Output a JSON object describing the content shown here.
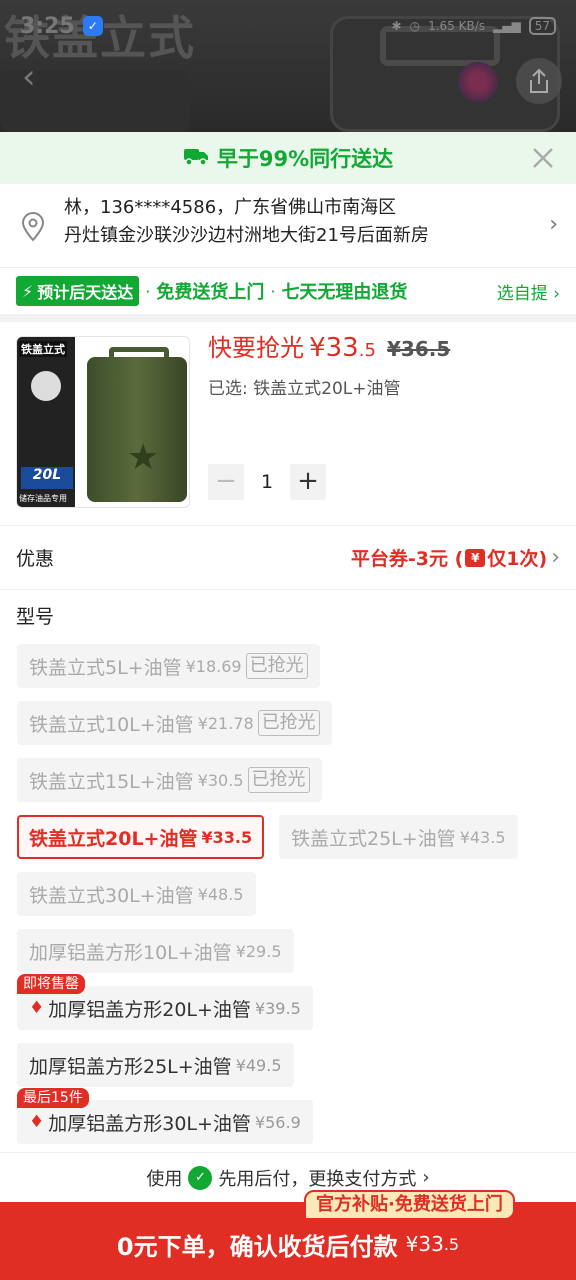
{
  "status_bar": {
    "time": "3:25",
    "network": "1.65 KB/s",
    "battery": "57"
  },
  "background": {
    "title": "铁盖立式"
  },
  "delivery_header": {
    "text": "早于99%同行送达"
  },
  "address": {
    "line1": "林，136****4586，广东省佛山市南海区",
    "line2": "丹灶镇金沙联沙沙边村洲地大街21号后面新房"
  },
  "promises": {
    "badge": "预计后天送达",
    "item1": "免费送货上门",
    "item2": "七天无理由退货",
    "pickup": "选自提"
  },
  "product": {
    "thumb_tag": "铁盖立式",
    "thumb_size": "20L",
    "thumb_note": "储存油品专用",
    "price_label": "快要抢光",
    "price_int": "¥33",
    "price_dec": ".5",
    "price_old": "¥36.5",
    "selected_text": "已选: 铁盖立式20L+油管",
    "quantity": "1",
    "minus": "−",
    "plus": "+"
  },
  "coupon": {
    "label": "优惠",
    "value_pre": "平台券-3元 (",
    "yen": "¥",
    "value_post": "仅1次)"
  },
  "model_title": "型号",
  "options": {
    "o1": {
      "name": "铁盖立式5L+油管",
      "price": "¥18",
      "dec": ".69",
      "sold": "已抢光"
    },
    "o2": {
      "name": "铁盖立式10L+油管",
      "price": "¥21",
      "dec": ".78",
      "sold": "已抢光"
    },
    "o3": {
      "name": "铁盖立式15L+油管",
      "price": "¥30",
      "dec": ".5",
      "sold": "已抢光"
    },
    "o4": {
      "name": "铁盖立式20L+油管",
      "price": "¥33",
      "dec": ".5"
    },
    "o5": {
      "name": "铁盖立式25L+油管",
      "price": "¥43",
      "dec": ".5"
    },
    "o6": {
      "name": "铁盖立式30L+油管",
      "price": "¥48",
      "dec": ".5"
    },
    "o7": {
      "name": "加厚铝盖方形10L+油管",
      "price": "¥29",
      "dec": ".5"
    },
    "o8": {
      "name": "加厚铝盖方形20L+油管",
      "price": "¥39",
      "dec": ".5",
      "tag": "即将售罄"
    },
    "o9": {
      "name": "加厚铝盖方形25L+油管",
      "price": "¥49",
      "dec": ".5"
    },
    "o10": {
      "name": "加厚铝盖方形30L+油管",
      "price": "¥56",
      "dec": ".9",
      "tag": "最后15件"
    }
  },
  "pay": {
    "pre": "使用",
    "post": "先用后付，更换支付方式"
  },
  "buy": {
    "text": "0元下单，确认收货后付款",
    "price": "¥33",
    "dec": ".5",
    "subsidy": "官方补贴·免费送货上门"
  },
  "colors": {
    "accent": "#e02e24",
    "green": "#12a834"
  }
}
